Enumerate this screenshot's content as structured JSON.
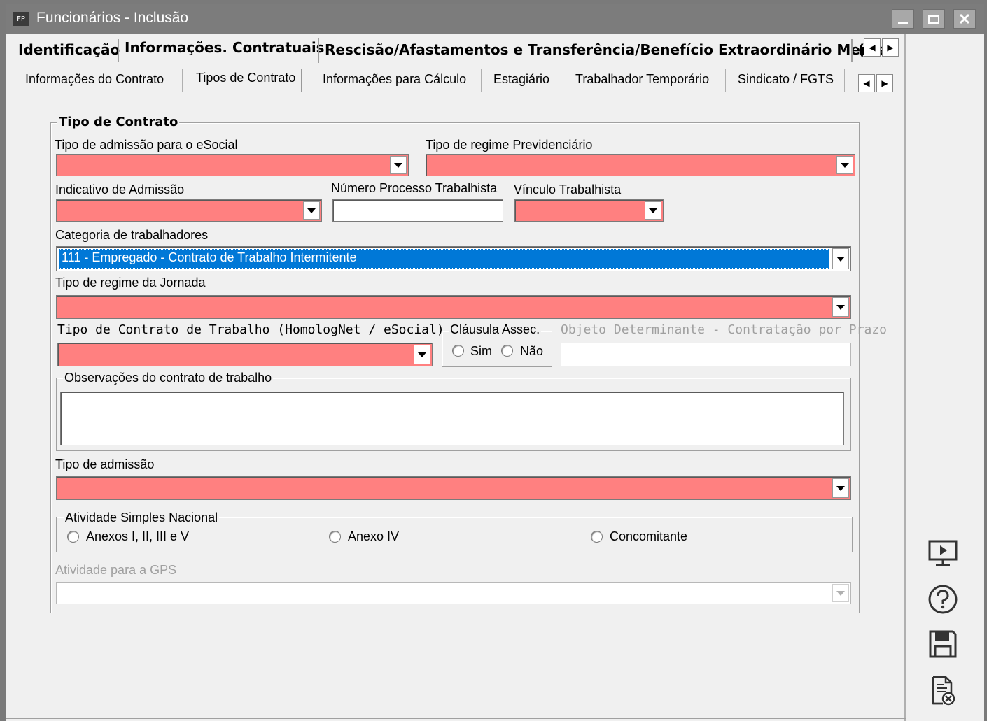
{
  "window": {
    "app_icon": "FP",
    "title": "Funcionários - Inclusão"
  },
  "main_tabs": [
    {
      "label": "Identificação"
    },
    {
      "label": "Informações. Contratuais"
    },
    {
      "label": "Rescisão/Afastamentos e Transferência/Benefício Extraordinário Mensal"
    },
    {
      "label": "("
    }
  ],
  "sub_tabs": [
    {
      "label": "Informações do Contrato"
    },
    {
      "label": "Tipos de Contrato"
    },
    {
      "label": "Informações para Cálculo"
    },
    {
      "label": "Estagiário"
    },
    {
      "label": "Trabalhador Temporário"
    },
    {
      "label": "Sindicato / FGTS"
    }
  ],
  "form": {
    "group_title": "Tipo de Contrato",
    "tipo_admissao_esocial": {
      "label": "Tipo de admissão para o eSocial",
      "value": ""
    },
    "tipo_regime_previdenciario": {
      "label": "Tipo de regime Previdenciário",
      "value": ""
    },
    "indicativo_admissao": {
      "label": "Indicativo de Admissão",
      "value": ""
    },
    "numero_processo": {
      "label": "Número Processo Trabalhista",
      "value": ""
    },
    "vinculo_trabalhista": {
      "label": "Vínculo Trabalhista",
      "value": ""
    },
    "categoria_trabalhadores": {
      "label": "Categoria de trabalhadores",
      "value": "111 - Empregado - Contrato de Trabalho Intermitente"
    },
    "tipo_regime_jornada": {
      "label": "Tipo de regime da Jornada",
      "value": ""
    },
    "tipo_contrato_trabalho": {
      "label": "Tipo de Contrato de Trabalho (HomologNet / eSocial)",
      "value": ""
    },
    "clausula_assec": {
      "label": "Cláusula Assec.",
      "options": [
        "Sim",
        "Não"
      ]
    },
    "objeto_determinante": {
      "label": "Objeto Determinante - Contratação por Prazo",
      "value": ""
    },
    "observacoes": {
      "label": "Observações do contrato de trabalho",
      "value": ""
    },
    "tipo_admissao": {
      "label": "Tipo de admissão",
      "value": ""
    },
    "atividade_simples": {
      "label": "Atividade Simples Nacional",
      "options": [
        "Anexos I, II, III e V",
        "Anexo IV",
        "Concomitante"
      ]
    },
    "atividade_gps": {
      "label": "Atividade para a GPS",
      "value": ""
    }
  },
  "side_toolbar": [
    "monitor-play-icon",
    "help-icon",
    "save-icon",
    "cancel-document-icon"
  ],
  "colors": {
    "required_field": "#ff8080",
    "selection": "#0078d7",
    "titlebar": "#7c7c7c"
  }
}
